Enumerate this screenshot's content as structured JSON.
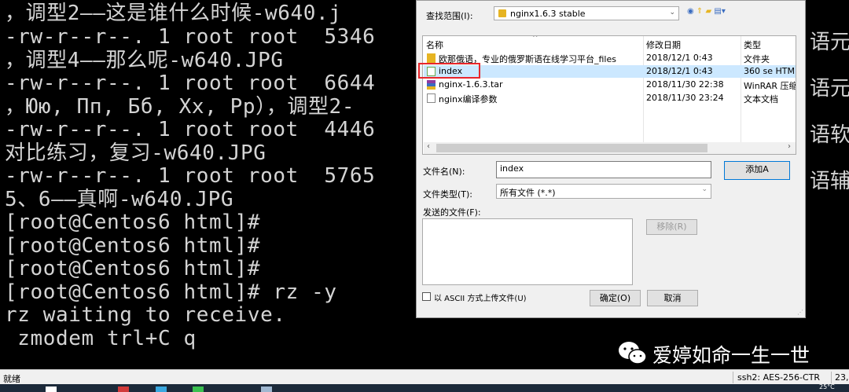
{
  "terminal": {
    "lines": [
      "，调型2——这是谁什么时候-w640.j",
      "-rw-r--r--. 1 root root  5346",
      "，调型4——那么呢-w640.JPG",
      "-rw-r--r--. 1 root root  6644",
      "，Юю, Пп, Бб, Хх, Рр），调型2-",
      "-rw-r--r--. 1 root root  4446",
      "对比练习，复习-w640.JPG",
      "-rw-r--r--. 1 root root  5765",
      "5、6——真啊-w640.JPG",
      "[root@Centos6 html]#",
      "[root@Centos6 html]#",
      "[root@Centos6 html]#",
      "[root@Centos6 html]# rz -y",
      "rz waiting to receive.",
      " zmodem trl+C q"
    ],
    "right_fragments": [
      "语元",
      "语元",
      "语软",
      "语辅"
    ]
  },
  "dialog": {
    "look_in_label": "查找范围(I):",
    "look_in_value": "nginx1.6.3 stable",
    "columns": {
      "name": "名称",
      "date": "修改日期",
      "type": "类型"
    },
    "files": [
      {
        "name": "欧那俄语，专业的俄罗斯语在线学习平台_files",
        "date": "2018/12/1 0:43",
        "type": "文件夹",
        "icon": "folder-icon"
      },
      {
        "name": "index",
        "date": "2018/12/1 0:43",
        "type": "360 se HTML",
        "icon": "html-file-icon"
      },
      {
        "name": "nginx-1.6.3.tar",
        "date": "2018/11/30 22:38",
        "type": "WinRAR 压缩",
        "icon": "archive-icon"
      },
      {
        "name": "nginx编译参数",
        "date": "2018/11/30 23:24",
        "type": "文本文档",
        "icon": "text-file-icon"
      }
    ],
    "filename_label": "文件名(N):",
    "filename_value": "index",
    "filetype_label": "文件类型(T):",
    "filetype_value": "所有文件 (*.*)",
    "add_button": "添加A",
    "sent_files_label": "发送的文件(F):",
    "remove_button": "移除(R)",
    "ascii_label": "以 ASCII 方式上传文件(U)",
    "ok_button": "确定(O)",
    "cancel_button": "取消"
  },
  "statusbar": {
    "ready": "就绪",
    "encryption": "ssh2: AES-256-CTR",
    "position": "23,",
    "temperature": "25°C"
  },
  "watermark": {
    "text": "爱婷如命一生一世"
  }
}
